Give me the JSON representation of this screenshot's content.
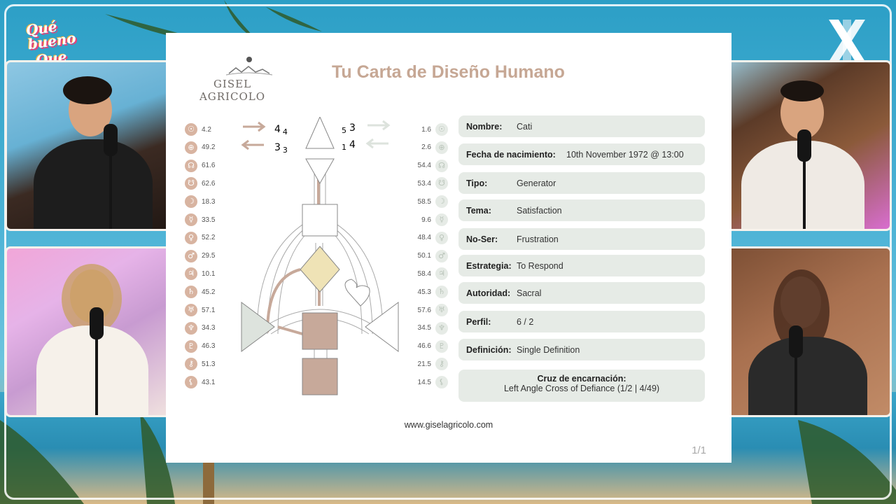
{
  "show_logo": {
    "line1": "Qué bueno",
    "line2": "Que viniste"
  },
  "slide": {
    "logo_text": "GISEL AGRICOLO",
    "title": "Tu Carta de Diseño Humano",
    "left_arrows": {
      "top_num": "4",
      "top_sub": "4",
      "bottom_num": "3",
      "bottom_sub": "3"
    },
    "right_arrows": {
      "top_num": "3",
      "top_pre": "5",
      "bottom_num": "4",
      "bottom_pre": "1"
    },
    "left_planets": [
      {
        "icon": "sun-icon",
        "glyph": "☉",
        "value": "4.2"
      },
      {
        "icon": "earth-icon",
        "glyph": "⊕",
        "value": "49.2"
      },
      {
        "icon": "north-node-icon",
        "glyph": "☊",
        "value": "61.6"
      },
      {
        "icon": "south-node-icon",
        "glyph": "☋",
        "value": "62.6"
      },
      {
        "icon": "moon-icon",
        "glyph": "☽",
        "value": "18.3"
      },
      {
        "icon": "mercury-icon",
        "glyph": "☿",
        "value": "33.5"
      },
      {
        "icon": "venus-icon",
        "glyph": "♀",
        "value": "52.2"
      },
      {
        "icon": "mars-icon",
        "glyph": "♂",
        "value": "29.5"
      },
      {
        "icon": "jupiter-icon",
        "glyph": "♃",
        "value": "10.1"
      },
      {
        "icon": "saturn-icon",
        "glyph": "♄",
        "value": "45.2"
      },
      {
        "icon": "uranus-icon",
        "glyph": "♅",
        "value": "57.1"
      },
      {
        "icon": "neptune-icon",
        "glyph": "♆",
        "value": "34.3"
      },
      {
        "icon": "pluto-icon",
        "glyph": "♇",
        "value": "46.3"
      },
      {
        "icon": "chiron-icon",
        "glyph": "⚷",
        "value": "51.3"
      },
      {
        "icon": "lilith-icon",
        "glyph": "⚸",
        "value": "43.1"
      }
    ],
    "right_planets": [
      {
        "icon": "sun-icon",
        "glyph": "☉",
        "value": "1.6"
      },
      {
        "icon": "earth-icon",
        "glyph": "⊕",
        "value": "2.6"
      },
      {
        "icon": "north-node-icon",
        "glyph": "☊",
        "value": "54.4"
      },
      {
        "icon": "south-node-icon",
        "glyph": "☋",
        "value": "53.4"
      },
      {
        "icon": "moon-icon",
        "glyph": "☽",
        "value": "58.5"
      },
      {
        "icon": "mercury-icon",
        "glyph": "☿",
        "value": "9.6"
      },
      {
        "icon": "venus-icon",
        "glyph": "♀",
        "value": "48.4"
      },
      {
        "icon": "mars-icon",
        "glyph": "♂",
        "value": "50.1"
      },
      {
        "icon": "jupiter-icon",
        "glyph": "♃",
        "value": "58.4"
      },
      {
        "icon": "saturn-icon",
        "glyph": "♄",
        "value": "45.3"
      },
      {
        "icon": "uranus-icon",
        "glyph": "♅",
        "value": "57.6"
      },
      {
        "icon": "neptune-icon",
        "glyph": "♆",
        "value": "34.5"
      },
      {
        "icon": "pluto-icon",
        "glyph": "♇",
        "value": "46.6"
      },
      {
        "icon": "chiron-icon",
        "glyph": "⚷",
        "value": "21.5"
      },
      {
        "icon": "lilith-icon",
        "glyph": "⚸",
        "value": "14.5"
      }
    ],
    "info": [
      {
        "label": "Nombre:",
        "value": "Cati"
      },
      {
        "label": "Fecha de nacimiento:",
        "value": "10th November 1972 @ 13:00"
      },
      {
        "label": "Tipo:",
        "value": "Generator"
      },
      {
        "label": "Tema:",
        "value": "Satisfaction"
      },
      {
        "label": "No-Ser:",
        "value": "Frustration"
      },
      {
        "label": "Estrategia:",
        "value": "To Respond"
      },
      {
        "label": "Autoridad:",
        "value": "Sacral"
      },
      {
        "label": "Perfil:",
        "value": "6 / 2"
      },
      {
        "label": "Definición:",
        "value": "Single Definition"
      }
    ],
    "cross": {
      "label": "Cruz de encarnación:",
      "value": "Left Angle Cross of Defiance (1/2 | 4/49)"
    },
    "website": "www.giselagricolo.com",
    "page_num": "1/1"
  },
  "colors": {
    "accent": "#c6a794",
    "card_bg": "#e6ebe6",
    "center_defined": "#c7a99a",
    "center_yellow": "#efe3b6"
  }
}
